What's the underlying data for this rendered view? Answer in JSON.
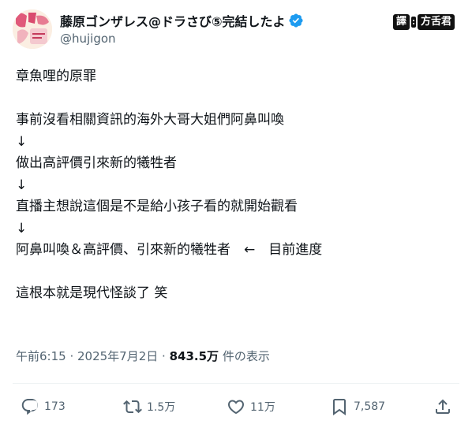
{
  "author": {
    "display_name": "藤原ゴンザレス@ドラさび⑤完結したよ",
    "handle": "@hujigon",
    "verified": true,
    "avatar_icon": "manga-cover-avatar"
  },
  "watermark": {
    "left": "譯",
    "right": "方舌君"
  },
  "tweet": {
    "lines": [
      "章魚哩的原罪",
      "",
      "事前沒看相關資訊的海外大哥大姐們阿鼻叫喚",
      "↓",
      "做出高評價引來新的犧牲者",
      "↓",
      "直播主想說這個是不是給小孩子看的就開始觀看",
      "↓",
      "阿鼻叫喚＆高評價、引來新的犧牲者　←　目前進度",
      "",
      "這根本就是現代怪談了 笑"
    ]
  },
  "meta": {
    "time": "午前6:15",
    "sep": " · ",
    "date": "2025年7月2日",
    "views_count": "843.5万",
    "views_label": "件の表示"
  },
  "actions": {
    "reply_count": "173",
    "retweet_count": "1.5万",
    "like_count": "11万",
    "bookmark_count": "7,587"
  },
  "colors": {
    "text": "#0f1419",
    "secondary": "#536471",
    "verified_blue": "#1d9bf0",
    "divider": "#eff3f4"
  }
}
